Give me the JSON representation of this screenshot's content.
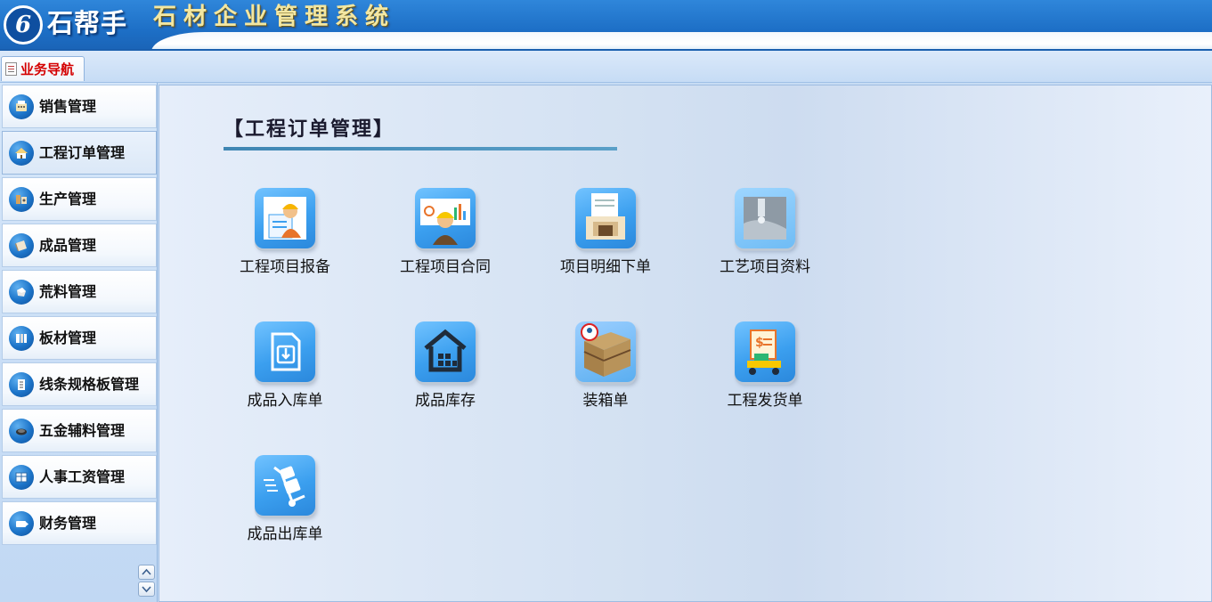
{
  "header": {
    "brand": "石帮手",
    "logo_glyph": "6",
    "system_title": "石材企业管理系统"
  },
  "tabbar": {
    "active_tab": "业务导航"
  },
  "sidebar": {
    "items": [
      {
        "label": "销售管理",
        "icon": "sales-icon"
      },
      {
        "label": "工程订单管理",
        "icon": "project-order-icon"
      },
      {
        "label": "生产管理",
        "icon": "production-icon"
      },
      {
        "label": "成品管理",
        "icon": "finished-goods-icon"
      },
      {
        "label": "荒料管理",
        "icon": "raw-block-icon"
      },
      {
        "label": "板材管理",
        "icon": "slab-icon"
      },
      {
        "label": "线条规格板管理",
        "icon": "molding-icon"
      },
      {
        "label": "五金辅料管理",
        "icon": "hardware-icon"
      },
      {
        "label": "人事工资管理",
        "icon": "hr-icon"
      },
      {
        "label": "财务管理",
        "icon": "finance-icon"
      }
    ],
    "active_index": 1
  },
  "main": {
    "section_title": "【工程订单管理】",
    "tiles": [
      {
        "label": "工程项目报备",
        "icon": "project-report-icon"
      },
      {
        "label": "工程项目合同",
        "icon": "project-contract-icon"
      },
      {
        "label": "项目明细下单",
        "icon": "detail-order-icon"
      },
      {
        "label": "工艺项目资料",
        "icon": "process-data-icon"
      },
      {
        "label": "成品入库单",
        "icon": "inbound-icon"
      },
      {
        "label": "成品库存",
        "icon": "warehouse-icon"
      },
      {
        "label": "装箱单",
        "icon": "packing-icon"
      },
      {
        "label": "工程发货单",
        "icon": "delivery-icon"
      },
      {
        "label": "成品出库单",
        "icon": "outbound-icon"
      }
    ]
  },
  "colors": {
    "header_blue": "#1d6fc6",
    "title_gold": "#f3e7a2",
    "tab_red": "#d40000",
    "tile_blue": "#3b9fef",
    "rule_teal": "#3f86b3"
  }
}
